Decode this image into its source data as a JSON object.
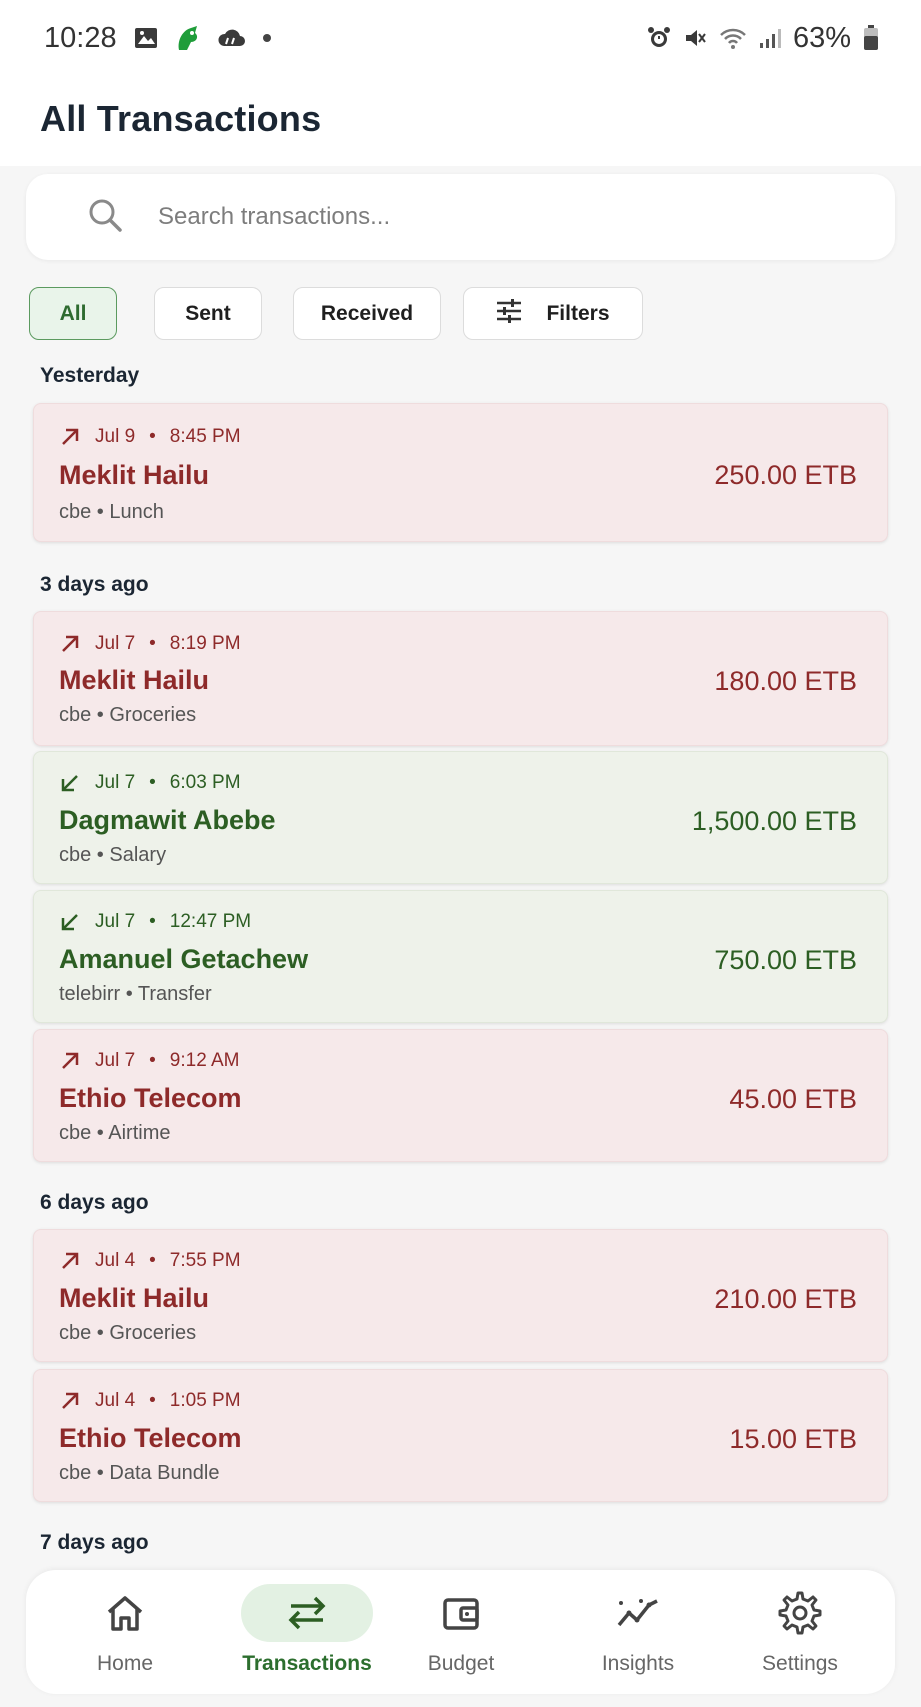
{
  "status_bar": {
    "time": "10:28",
    "battery": "63%",
    "left_icons": [
      "image-icon",
      "app-icon",
      "weather-icon",
      "dot"
    ],
    "right_icons": [
      "alarm-icon",
      "mute-icon",
      "wifi-icon",
      "signal-icon",
      "battery-icon"
    ]
  },
  "header": {
    "title": "All Transactions"
  },
  "search": {
    "placeholder": "Search transactions..."
  },
  "filters": {
    "chips": [
      {
        "label": "All",
        "active": true
      },
      {
        "label": "Sent",
        "active": false
      },
      {
        "label": "Received",
        "active": false
      }
    ],
    "filters_label": "Filters"
  },
  "sections": [
    {
      "label": "Yesterday",
      "transactions": [
        {
          "type": "sent",
          "date": "Jul 9",
          "time": "8:45 PM",
          "name": "Meklit Hailu",
          "source": "cbe",
          "category": "Lunch",
          "amount": "250.00 ETB"
        }
      ]
    },
    {
      "label": "3 days ago",
      "transactions": [
        {
          "type": "sent",
          "date": "Jul 7",
          "time": "8:19 PM",
          "name": "Meklit Hailu",
          "source": "cbe",
          "category": "Groceries",
          "amount": "180.00 ETB"
        },
        {
          "type": "received",
          "date": "Jul 7",
          "time": "6:03 PM",
          "name": "Dagmawit Abebe",
          "source": "cbe",
          "category": "Salary",
          "amount": "1,500.00 ETB"
        },
        {
          "type": "received",
          "date": "Jul 7",
          "time": "12:47 PM",
          "name": "Amanuel Getachew",
          "source": "telebirr",
          "category": "Transfer",
          "amount": "750.00 ETB"
        },
        {
          "type": "sent",
          "date": "Jul 7",
          "time": "9:12 AM",
          "name": "Ethio Telecom",
          "source": "cbe",
          "category": "Airtime",
          "amount": "45.00 ETB"
        }
      ]
    },
    {
      "label": "6 days ago",
      "transactions": [
        {
          "type": "sent",
          "date": "Jul 4",
          "time": "7:55 PM",
          "name": "Meklit Hailu",
          "source": "cbe",
          "category": "Groceries",
          "amount": "210.00 ETB"
        },
        {
          "type": "sent",
          "date": "Jul 4",
          "time": "1:05 PM",
          "name": "Ethio Telecom",
          "source": "cbe",
          "category": "Data Bundle",
          "amount": "15.00 ETB"
        }
      ]
    },
    {
      "label": "7 days ago",
      "transactions": []
    }
  ],
  "bottom_nav": {
    "items": [
      {
        "label": "Home",
        "icon": "home-icon",
        "active": false
      },
      {
        "label": "Transactions",
        "icon": "transfer-icon",
        "active": true
      },
      {
        "label": "Budget",
        "icon": "wallet-icon",
        "active": false
      },
      {
        "label": "Insights",
        "icon": "trend-icon",
        "active": false
      },
      {
        "label": "Settings",
        "icon": "gear-icon",
        "active": false
      }
    ]
  },
  "colors": {
    "sent_text": "#8e2a2a",
    "sent_bg": "#f6e9ea",
    "received_text": "#2c5e23",
    "received_bg": "#eef2ea",
    "accent": "#2c6e2e"
  }
}
